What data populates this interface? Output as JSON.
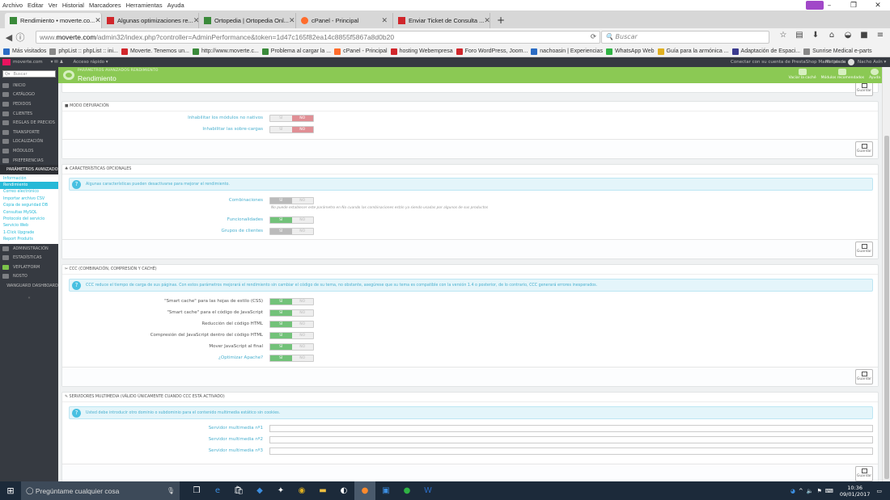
{
  "menubar": {
    "items": [
      "Archivo",
      "Editar",
      "Ver",
      "Historial",
      "Marcadores",
      "Herramientas",
      "Ayuda"
    ]
  },
  "tabs": [
    {
      "title": "Rendimiento • moverte.co...",
      "color": "#3a8a3a",
      "active": true
    },
    {
      "title": "Algunas optimizaciones re...",
      "color": "#d0262b",
      "active": false
    },
    {
      "title": "Ortopedia | Ortopedia Onl...",
      "color": "#3a8a3a",
      "active": false
    },
    {
      "title": "cPanel - Principal",
      "color": "#ff6c2c",
      "active": false
    },
    {
      "title": "Enviar Ticket de Consulta ...",
      "color": "#d0262b",
      "active": false
    }
  ],
  "url": {
    "prefix": "www.",
    "domain": "moverte.com",
    "path": "/admin32/index.php?controller=AdminPerformance&token=1d47c165f82ea14c8855f5867a8d0b20"
  },
  "search": {
    "placeholder": "Buscar"
  },
  "bookmarks": [
    {
      "label": "Más visitados",
      "color": "#2b6cc4"
    },
    {
      "label": "phpList :: phpList :: ini...",
      "color": "#888"
    },
    {
      "label": "Moverte. Tenemos un...",
      "color": "#d0262b"
    },
    {
      "label": "http://www.moverte.c...",
      "color": "#3a8a3a"
    },
    {
      "label": "Problema al cargar la ...",
      "color": "#3a8a3a"
    },
    {
      "label": "cPanel - Principal",
      "color": "#ff6c2c"
    },
    {
      "label": "hosting Webempresa",
      "color": "#d0262b"
    },
    {
      "label": "Foro WordPress, Joom...",
      "color": "#d0262b"
    },
    {
      "label": "nachoasin | Experiencias",
      "color": "#2b6cc4"
    },
    {
      "label": "WhatsApp Web",
      "color": "#2fb344"
    },
    {
      "label": "Guía para la armónica ...",
      "color": "#e0b020"
    },
    {
      "label": "Adaptación de Espaci...",
      "color": "#3b3b8f"
    },
    {
      "label": "Sunrise Medical e-parts",
      "color": "#888"
    }
  ],
  "ps_header": {
    "site": "moverte.com",
    "quick": "Acceso rápido ▾",
    "connect": "Conectar con su cuenta de PrestaShop Marketplace",
    "shop": "Mi tienda",
    "user": "Nacho Asín ▾"
  },
  "sidebar": {
    "search_placeholder": "Buscar",
    "items_top": [
      "Inicio",
      "Catálogo",
      "Pedidos",
      "Clientes",
      "Reglas de precios",
      "Transporte",
      "Localización",
      "Módulos",
      "Preferencias",
      "Parámetros avanzados"
    ],
    "sub_items": [
      "Información",
      "Rendimiento",
      "Correo electrónico",
      "Importar archivo CSV",
      "Copia de seguridad DB",
      "Consultas MySQL",
      "Protocolo del servicio",
      "Servicio Web",
      "1-Click Upgrade",
      "Report Produits"
    ],
    "items_bottom": [
      "Administración",
      "Estadísticas",
      "Veplatform",
      "Nosto",
      "Wanguard Dashboard"
    ]
  },
  "toolbar": {
    "breadcrumb": "PARÁMETROS AVANZADOS   RENDIMIENTO",
    "title": "Rendimiento",
    "buttons": [
      "Vaciar la caché",
      "Módulos recomendados",
      "Ayuda"
    ]
  },
  "save_label": "Guardar",
  "debug_panel": {
    "header": "MODO DEPURACIÓN",
    "rows": [
      {
        "label": "Inhabilitar los módulos no nativos",
        "yes": "SÍ",
        "no": "NO"
      },
      {
        "label": "Inhabilitar las sobre-cargas",
        "yes": "SÍ",
        "no": "NO"
      }
    ]
  },
  "features_panel": {
    "header": "CARACTERÍSTICAS OPCIONALES",
    "info": "Algunas características pueden desactivarse para mejorar el rendimiento.",
    "rows": [
      {
        "label": "Combinaciones",
        "yes": "SÍ",
        "no": "NO",
        "hint": "No puede establecer este parámetro en No cuando las combinaciones están ya siendo usadas por algunos de sus productos"
      },
      {
        "label": "Funcionalidades",
        "yes": "SÍ",
        "no": "NO"
      },
      {
        "label": "Grupos de clientes",
        "yes": "SÍ",
        "no": "NO"
      }
    ]
  },
  "ccc_panel": {
    "header": "CCC (COMBINACIÓN, COMPRESIÓN Y CACHÉ)",
    "info": "CCC reduce el tiempo de carga de sus páginas. Con estos parámetros mejorará el rendimiento sin cambiar el código de su tema, no obstante, asegúrese que su tema es compatible con la versión 1.4 o posterior, de lo contrario, CCC generará errores inesperados.",
    "rows": [
      {
        "label": "\"Smart cache\" para las hojas de estilo (CSS)",
        "yes": "SÍ",
        "no": "NO"
      },
      {
        "label": "\"Smart cache\" para el código de JavaScript",
        "yes": "SÍ",
        "no": "NO"
      },
      {
        "label": "Reducción del código HTML",
        "yes": "SÍ",
        "no": "NO"
      },
      {
        "label": "Compresión del JavaScript dentro del código HTML",
        "yes": "SÍ",
        "no": "NO"
      },
      {
        "label": "Mover JavaScript al final",
        "yes": "SÍ",
        "no": "NO"
      },
      {
        "label": "¿Optimizar Apache?",
        "yes": "SÍ",
        "no": "NO"
      }
    ]
  },
  "media_panel": {
    "header": "SERVIDORES MULTIMEDIA (VÁLIDO ÚNICAMENTE CUANDO CCC ESTÁ ACTIVADO)",
    "info": "Usted debe introducir otro dominio o subdominio para el contenido multimedia estático sin cookies.",
    "rows": [
      {
        "label": "Servidor multimedia nº1",
        "value": ""
      },
      {
        "label": "Servidor multimedia nº2",
        "value": ""
      },
      {
        "label": "Servidor multimedia nº3",
        "value": ""
      }
    ]
  },
  "taskbar": {
    "search": "Pregúntame cualquier cosa",
    "time": "10:36",
    "date": "09/01/2017"
  }
}
